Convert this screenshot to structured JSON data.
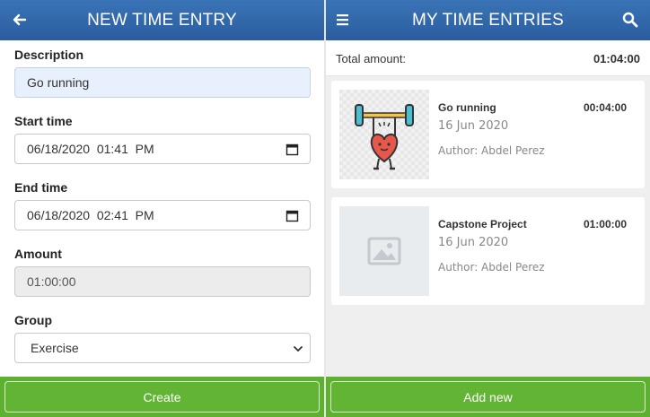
{
  "left": {
    "title": "NEW TIME ENTRY",
    "back_icon": "arrow-left-icon",
    "form": {
      "description_label": "Description",
      "description_value": "Go running",
      "start_label": "Start time",
      "start_value": "06/18/2020  01:41  PM",
      "end_label": "End time",
      "end_value": "06/18/2020  02:41  PM",
      "amount_label": "Amount",
      "amount_value": "01:00:00",
      "group_label": "Group",
      "group_value": "Exercise"
    },
    "create_label": "Create"
  },
  "right": {
    "title": "MY TIME ENTRIES",
    "menu_icon": "hamburger-menu-icon",
    "search_icon": "search-icon",
    "total_label": "Total amount:",
    "total_value": "01:04:00",
    "entries": [
      {
        "title": "Go running",
        "date": "16 Jun 2020",
        "author": "Author: Abdel Perez",
        "duration": "00:04:00",
        "thumbnail": "weightlifting-heart-icon"
      },
      {
        "title": "Capstone Project",
        "date": "16 Jun 2020",
        "author": "Author: Abdel Perez",
        "duration": "01:00:00",
        "thumbnail": "image-placeholder-icon"
      }
    ],
    "add_label": "Add new"
  },
  "colors": {
    "header_blue": "#2f65a8",
    "action_green": "#5eb130",
    "description_bg": "#e8f0fe"
  }
}
